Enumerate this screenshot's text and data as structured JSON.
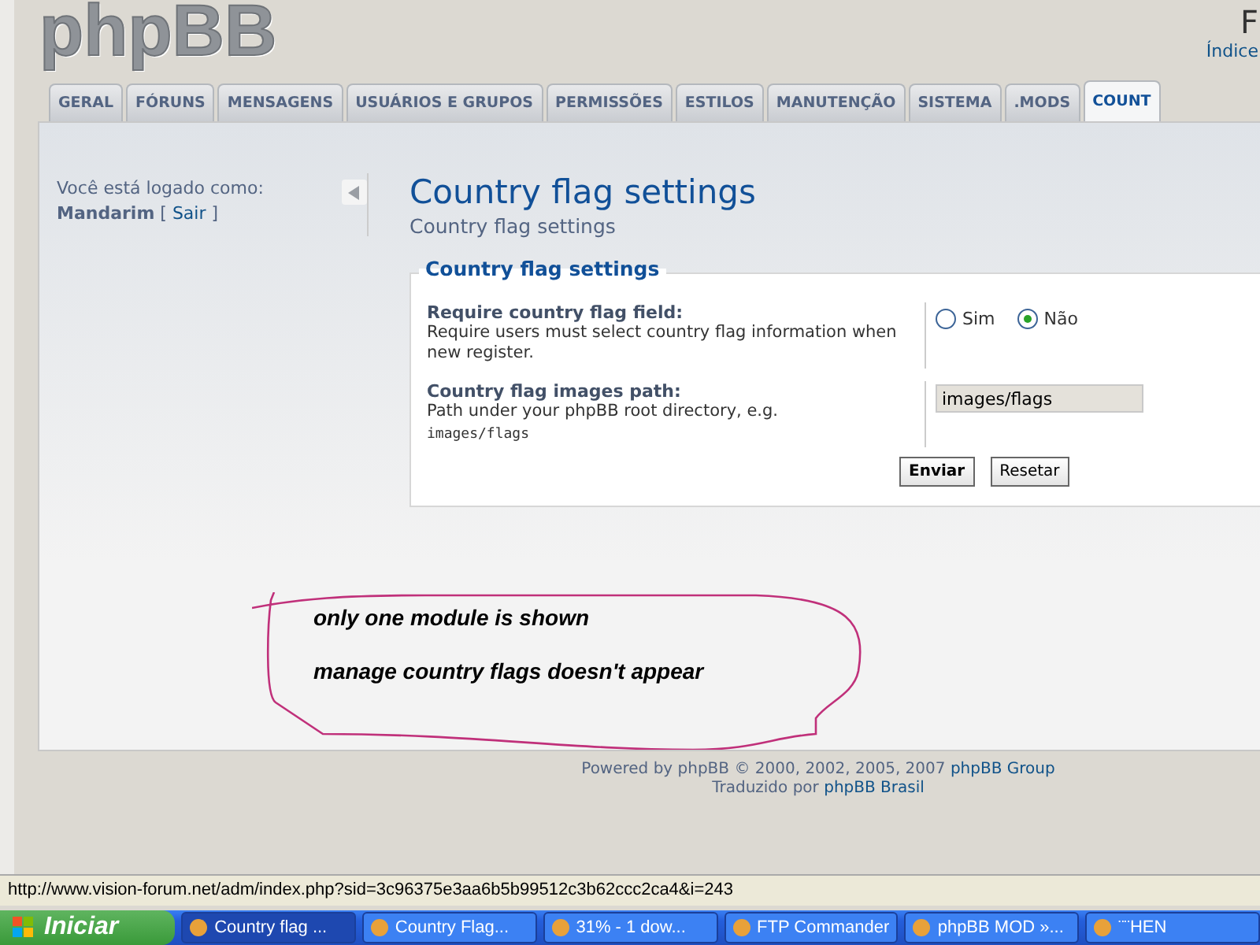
{
  "header": {
    "logo": "phpBB",
    "title_partial": "F",
    "index_link": "Índice"
  },
  "tabs": [
    {
      "label": "GERAL",
      "selected": false
    },
    {
      "label": "FÓRUNS",
      "selected": false
    },
    {
      "label": "MENSAGENS",
      "selected": false
    },
    {
      "label": "USUÁRIOS E GRUPOS",
      "selected": false
    },
    {
      "label": "PERMISSÕES",
      "selected": false
    },
    {
      "label": "ESTILOS",
      "selected": false
    },
    {
      "label": "MANUTENÇÃO",
      "selected": false
    },
    {
      "label": "SISTEMA",
      "selected": false
    },
    {
      "label": ".MODS",
      "selected": false
    },
    {
      "label": "COUNT",
      "selected": true
    }
  ],
  "sidebar": {
    "logged_in_label": "Você está logado como:",
    "username": "Mandarim",
    "logout_open": "[",
    "logout_link": "Sair",
    "logout_close": "]"
  },
  "page": {
    "title": "Country flag settings",
    "subtitle": "Country flag settings"
  },
  "fieldset": {
    "legend": "Country flag settings",
    "rows": [
      {
        "kind": "radio",
        "label": "Require country flag field:",
        "explain": "Require users must select country flag information when new register.",
        "options": [
          {
            "label": "Sim",
            "selected": false
          },
          {
            "label": "Não",
            "selected": true
          }
        ]
      },
      {
        "kind": "text",
        "label": "Country flag images path:",
        "explain": "Path under your phpBB root directory, e.g.",
        "example": "images/flags",
        "value": "images/flags"
      }
    ],
    "buttons": [
      {
        "label": "Enviar",
        "primary": true
      },
      {
        "label": "Resetar",
        "primary": false
      }
    ]
  },
  "annotation": {
    "lines": [
      "only one module is shown",
      "manage country flags doesn't appear"
    ]
  },
  "footer": {
    "powered": "Powered by phpBB © 2000, 2002, 2005, 2007",
    "powered_link": "phpBB Group",
    "translated": "Traduzido por",
    "translated_link": "phpBB Brasil"
  },
  "status_bar": {
    "url": "http://www.vision-forum.net/adm/index.php?sid=3c96375e3aa6b5b99512c3b62ccc2ca4&i=243"
  },
  "taskbar": {
    "start": "Iniciar",
    "items": [
      {
        "label": "Country flag ...",
        "selected": true
      },
      {
        "label": "Country Flag...",
        "selected": false
      },
      {
        "label": "31% - 1 dow...",
        "selected": false
      },
      {
        "label": "FTP Commander",
        "selected": false
      },
      {
        "label": "phpBB MOD »...",
        "selected": false
      },
      {
        "label": "¨¨HEN",
        "selected": false
      }
    ]
  }
}
